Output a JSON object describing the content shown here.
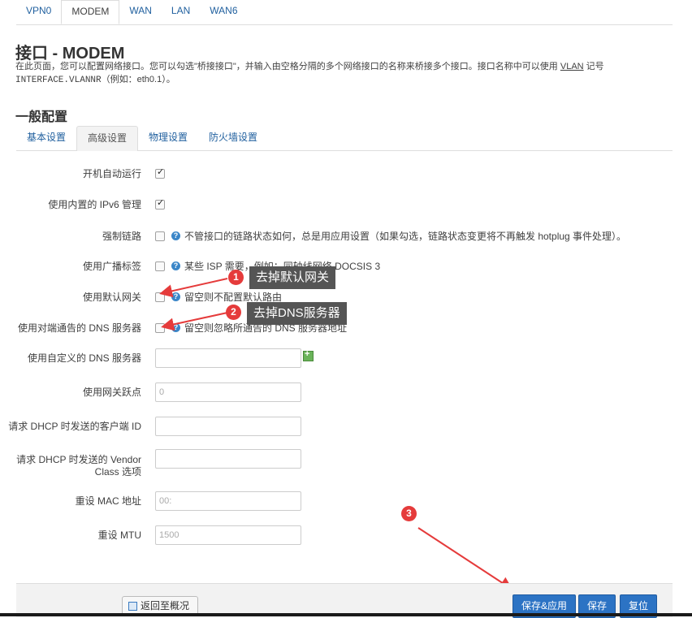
{
  "top_tabs": [
    "VPN0",
    "MODEM",
    "WAN",
    "LAN",
    "WAN6"
  ],
  "title": "接口 - MODEM",
  "description": {
    "line1_a": "在此页面，您可以配置网络接口。您可以勾选\"桥接接口\"，并输入由空格分隔的多个网络接口的名称来桥接多个接口。接口名称中可以使用 ",
    "vlan": "VLAN",
    "line1_b": " 记号",
    "line2_code": "INTERFACE.VLANNR",
    "line2_rest": "（例如：eth0.1）。"
  },
  "section_title": "一般配置",
  "sub_tabs": [
    "基本设置",
    "高级设置",
    "物理设置",
    "防火墙设置"
  ],
  "fields": {
    "autostart": {
      "label": "开机自动运行",
      "checked": true
    },
    "ipv6": {
      "label": "使用内置的 IPv6 管理",
      "checked": true
    },
    "force_link": {
      "label": "强制链路",
      "checked": false,
      "help": "不管接口的链路状态如何，总是用应用设置（如果勾选，链路状态变更将不再触发 hotplug 事件处理）。"
    },
    "broadcast": {
      "label": "使用广播标签",
      "checked": false,
      "help": "某些 ISP 需要，例如：同轴线网络 DOCSIS 3"
    },
    "default_gw": {
      "label": "使用默认网关",
      "checked": false,
      "help": "留空则不配置默认路由"
    },
    "peer_dns": {
      "label": "使用对端通告的 DNS 服务器",
      "checked": false,
      "help": "留空则忽略所通告的 DNS 服务器地址"
    },
    "custom_dns": {
      "label": "使用自定义的 DNS 服务器",
      "value": ""
    },
    "metric": {
      "label": "使用网关跃点",
      "value": "0"
    },
    "client_id": {
      "label": "请求 DHCP 时发送的客户端 ID",
      "value": ""
    },
    "vendor_class_a": "请求 DHCP 时发送的 Vendor",
    "vendor_class_b": "Class 选项",
    "mac": {
      "label": "重设 MAC 地址",
      "value": "00:"
    },
    "mtu": {
      "label": "重设 MTU",
      "value": "1500"
    }
  },
  "annotations": {
    "badge1": "1",
    "text1": "去掉默认网关",
    "badge2": "2",
    "text2": "去掉DNS服务器",
    "badge3": "3"
  },
  "footer": {
    "back": "返回至概况",
    "save_apply": "保存&应用",
    "save": "保存",
    "reset": "复位"
  },
  "colors": {
    "accent": "#2c73c4",
    "annotation_red": "#e53b3b",
    "callout_bg": "#555555"
  }
}
